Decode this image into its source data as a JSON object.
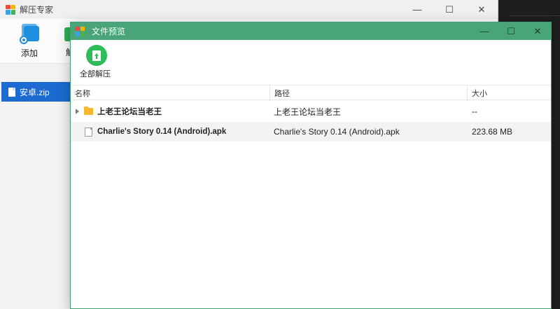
{
  "back_window": {
    "title": "解压专家",
    "controls": {
      "minimize": "—",
      "maximize": "☐",
      "close": "✕"
    },
    "toolbar": {
      "add_label": "添加",
      "partial_label": "解"
    },
    "sidebar": {
      "file": "安卓.zip"
    }
  },
  "dialog": {
    "title": "文件预览",
    "controls": {
      "minimize": "—",
      "maximize": "☐",
      "close": "✕"
    },
    "toolbar": {
      "extract_all_label": "全部解压"
    },
    "table": {
      "headers": {
        "name": "名称",
        "path": "路径",
        "size": "大小"
      },
      "rows": [
        {
          "type": "folder",
          "name": "上老王论坛当老王",
          "path": "上老王论坛当老王",
          "size": "--"
        },
        {
          "type": "file",
          "name": "Charlie's Story 0.14 (Android).apk",
          "path": "Charlie's Story 0.14 (Android).apk",
          "size": "223.68 MB"
        }
      ]
    }
  },
  "colors": {
    "dialog_titlebar": "#49a579",
    "selected_sidebar": "#1c6bd0",
    "extract_button": "#2fbd5a",
    "folder": "#f3b82d"
  }
}
